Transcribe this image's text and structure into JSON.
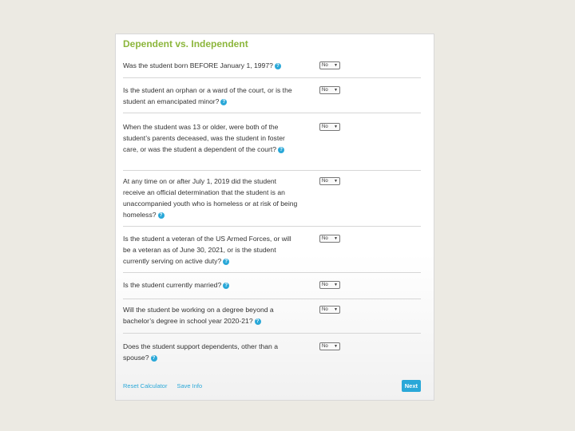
{
  "form": {
    "title": "Dependent vs. Independent",
    "questions": [
      {
        "text": "Was the student born BEFORE January 1, 1997?",
        "answer": "No"
      },
      {
        "text": "Is the student an orphan or a ward of the court, or is the student an emancipated minor?",
        "answer": "No"
      },
      {
        "text": "When the student was 13 or older, were both of the student’s parents deceased, was the student in foster care, or was the student a dependent of the court?",
        "answer": "No"
      },
      {
        "text": "At any time on or after July 1, 2019 did the student receive an official determination that the student is an unaccompanied youth who is homeless or at risk of being homeless?",
        "answer": "No"
      },
      {
        "text": "Is the student a veteran of the US Armed Forces, or will be a veteran as of June 30, 2021, or is the student currently serving on active duty?",
        "answer": "No"
      },
      {
        "text": "Is the student currently married?",
        "answer": "No"
      },
      {
        "text": "Will the student be working on a degree beyond a bachelor’s degree in school year 2020-21?",
        "answer": "No"
      },
      {
        "text": "Does the student support dependents, other than a spouse?",
        "answer": "No"
      }
    ],
    "help_icon": "question-circle-icon",
    "dropdown_icon": "chevron-down-icon"
  },
  "footer": {
    "reset_label": "Reset Calculator",
    "save_label": "Save Info",
    "next_label": "Next"
  },
  "colors": {
    "title": "#8cb63c",
    "accent": "#2aa8d8",
    "background": "#eceae3"
  }
}
